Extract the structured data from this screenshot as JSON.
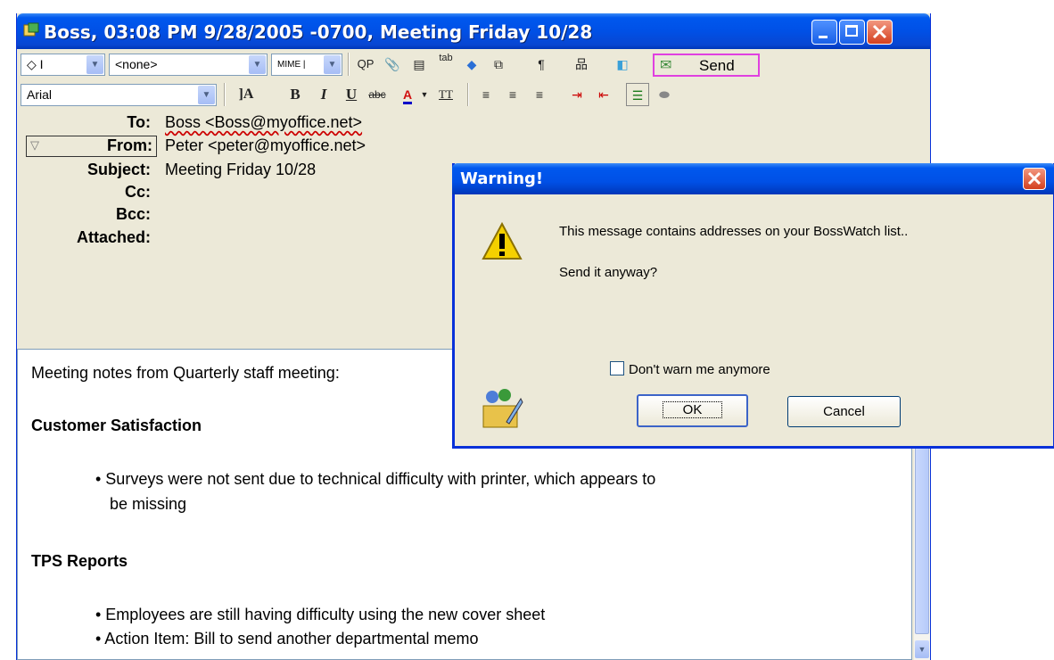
{
  "window": {
    "title": "Boss, 03:08 PM 9/28/2005 -0700, Meeting Friday 10/28"
  },
  "toolbar1": {
    "signature_value": "◇ I",
    "stationery_value": "<none>",
    "mime_value": "MIME |",
    "qp_label": "QP",
    "tab_label": "tab",
    "paragraph_label": "¶",
    "send_label": "Send"
  },
  "toolbar2": {
    "font_value": "Arial",
    "size_label": "]A",
    "bold_label": "B",
    "italic_label": "I",
    "underline_label": "U",
    "strike_label": "abc",
    "tt_label": "TT"
  },
  "headers": {
    "to_label": "To:",
    "to_value": "Boss <Boss@myoffice.net>",
    "from_label": "From:",
    "from_value": "Peter <peter@myoffice.net>",
    "subject_label": "Subject:",
    "subject_value": "Meeting Friday 10/28",
    "cc_label": "Cc:",
    "bcc_label": "Bcc:",
    "attached_label": "Attached:"
  },
  "body": {
    "intro": "Meeting notes from Quarterly staff meeting:",
    "section1_heading": "Customer Satisfaction",
    "section1_bullet1_line1": "• Surveys were not sent due to technical difficulty with printer, which appears to",
    "section1_bullet1_line2": "be missing",
    "section2_heading": "TPS Reports",
    "section2_bullet1": "• Employees are still having difficulty using the new cover sheet",
    "section2_bullet2": "• Action Item: Bill to send another departmental memo"
  },
  "dialog": {
    "title": "Warning!",
    "message": "This message contains addresses on your BossWatch list..",
    "question": "Send it anyway?",
    "checkbox_label": "Don't warn me anymore",
    "checkbox_checked": false,
    "ok_label": "OK",
    "cancel_label": "Cancel"
  },
  "colors": {
    "titlebar_blue": "#0054e3",
    "dialog_face": "#ece9d8",
    "send_border": "#e040e0",
    "close_red": "#d4401f"
  }
}
